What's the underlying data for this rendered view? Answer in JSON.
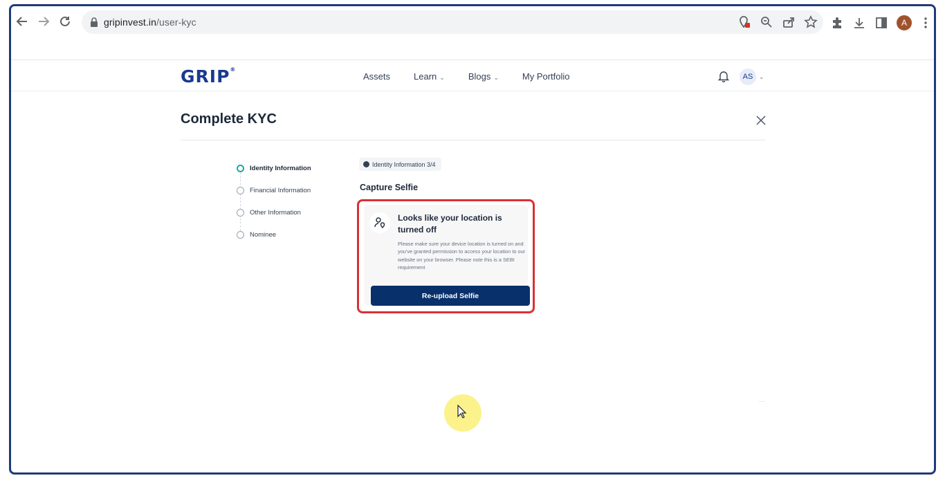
{
  "browser": {
    "url_domain": "gripinvest.in",
    "url_path": "/user-kyc",
    "profile_initial": "A"
  },
  "site": {
    "logo_text": "GRIP",
    "logo_mark": "®",
    "nav": [
      {
        "label": "Assets",
        "has_dropdown": false
      },
      {
        "label": "Learn",
        "has_dropdown": true
      },
      {
        "label": "Blogs",
        "has_dropdown": true
      },
      {
        "label": "My Portfolio",
        "has_dropdown": false
      }
    ],
    "avatar_initials": "AS"
  },
  "page": {
    "title": "Complete KYC",
    "steps": [
      {
        "label": "Identity Information",
        "active": true
      },
      {
        "label": "Financial Information",
        "active": false
      },
      {
        "label": "Other Information",
        "active": false
      },
      {
        "label": "Nominee",
        "active": false
      }
    ],
    "progress_badge": "Identity Information 3/4",
    "section_title": "Capture Selfie",
    "alert": {
      "title": "Looks like your location is turned off",
      "body": "Please make sure your device location is turned on and you've granted permission to access your location to our website on your browser. Please note this is a SEBI requirement",
      "button_label": "Re-upload Selfie"
    }
  },
  "colors": {
    "brand": "#1a3a8f",
    "button": "#08306b",
    "active_step": "#1aa8a0",
    "highlight_border": "#d93035"
  }
}
